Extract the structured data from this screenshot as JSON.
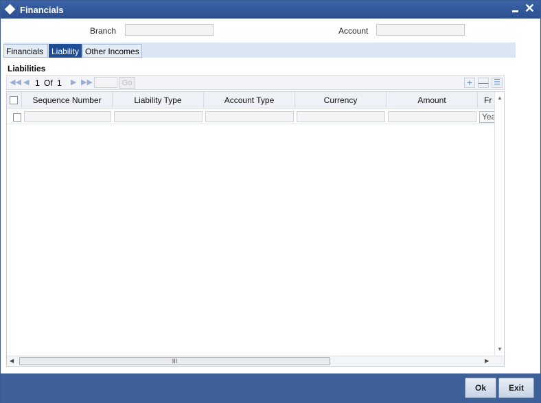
{
  "window": {
    "title": "Financials",
    "minimize_icon": "minimize-icon",
    "close_icon": "close-icon",
    "close_glyph": "✕"
  },
  "header": {
    "branch_label": "Branch",
    "branch_value": "",
    "account_label": "Account",
    "account_value": ""
  },
  "tabs": [
    {
      "label": "Financials",
      "active": false
    },
    {
      "label": "Liability",
      "active": true
    },
    {
      "label": "Other Incomes",
      "active": false
    }
  ],
  "liabilities": {
    "section_title": "Liabilities",
    "pager": {
      "current": "1",
      "of_label": "Of",
      "total": "1",
      "page_input": "",
      "go_label": "Go"
    },
    "columns": [
      "Sequence Number",
      "Liability Type",
      "Account Type",
      "Currency",
      "Amount",
      "Fr"
    ],
    "rows": [
      {
        "checked": false,
        "sequence_number": "",
        "liability_type": "",
        "account_type": "",
        "currency": "",
        "amount": "",
        "frequency": "Yearly"
      }
    ],
    "scroll_thumb_glyph": "III"
  },
  "footer": {
    "ok_label": "Ok",
    "exit_label": "Exit"
  }
}
